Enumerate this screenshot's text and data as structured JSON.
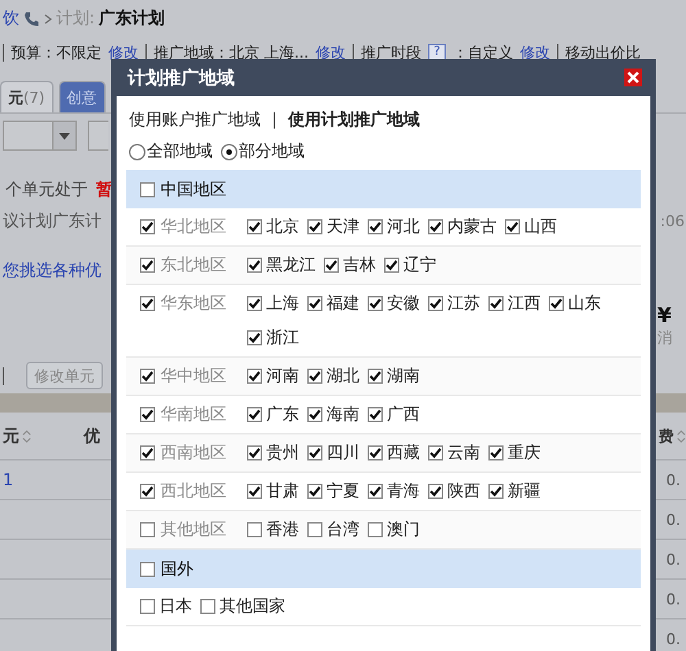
{
  "page": {
    "breadcrumb": {
      "parent": "饮",
      "section": "计划:",
      "current": "广东计划"
    },
    "info_bar": [
      {
        "label": "预算：不限定",
        "link": "修改"
      },
      {
        "label": "推广地域：北京 上海...",
        "link": "修改"
      },
      {
        "label": "推广时段",
        "help": "?",
        "suffix": "：自定义",
        "link": "修改"
      },
      {
        "label": "移动出价比"
      }
    ],
    "tabs": [
      {
        "label": "元",
        "count": "(7)",
        "selected": true
      },
      {
        "label": "创意",
        "selected": false
      }
    ],
    "notice": {
      "text": "个单元处于",
      "status": "暂"
    },
    "suggestion": "议计划广东计",
    "time": ":06",
    "promo_link": "您挑选各种优",
    "spend": {
      "amount": "¥",
      "label": "消"
    },
    "edit_button": "修改单元",
    "table": {
      "columns": [
        "元",
        "优",
        "费"
      ],
      "rows": [
        {
          "column_1": "1",
          "column_3": "0."
        },
        {
          "column_3": "0."
        },
        {
          "column_3": "0."
        },
        {
          "column_3": "0."
        },
        {
          "column_3": "0."
        }
      ]
    }
  },
  "dialog": {
    "title": "计划推广地域",
    "source_separator": "|",
    "source_tabs": [
      {
        "label": "使用账户推广地域",
        "selected": false
      },
      {
        "label": "使用计划推广地域",
        "selected": true
      }
    ],
    "scope": [
      {
        "label": "全部地域",
        "selected": false
      },
      {
        "label": "部分地域",
        "selected": true
      }
    ],
    "groups": [
      {
        "label": "中国地区",
        "checked": false,
        "regions": [
          {
            "label": "华北地区",
            "checked": true,
            "items": [
              {
                "label": "北京",
                "checked": true
              },
              {
                "label": "天津",
                "checked": true
              },
              {
                "label": "河北",
                "checked": true
              },
              {
                "label": "内蒙古",
                "checked": true
              },
              {
                "label": "山西",
                "checked": true
              }
            ]
          },
          {
            "label": "东北地区",
            "checked": true,
            "items": [
              {
                "label": "黑龙江",
                "checked": true
              },
              {
                "label": "吉林",
                "checked": true
              },
              {
                "label": "辽宁",
                "checked": true
              }
            ]
          },
          {
            "label": "华东地区",
            "checked": true,
            "items": [
              {
                "label": "上海",
                "checked": true
              },
              {
                "label": "福建",
                "checked": true
              },
              {
                "label": "安徽",
                "checked": true
              },
              {
                "label": "江苏",
                "checked": true
              },
              {
                "label": "江西",
                "checked": true
              },
              {
                "label": "山东",
                "checked": true
              },
              {
                "label": "浙江",
                "checked": true
              }
            ]
          },
          {
            "label": "华中地区",
            "checked": true,
            "items": [
              {
                "label": "河南",
                "checked": true
              },
              {
                "label": "湖北",
                "checked": true
              },
              {
                "label": "湖南",
                "checked": true
              }
            ]
          },
          {
            "label": "华南地区",
            "checked": true,
            "items": [
              {
                "label": "广东",
                "checked": true
              },
              {
                "label": "海南",
                "checked": true
              },
              {
                "label": "广西",
                "checked": true
              }
            ]
          },
          {
            "label": "西南地区",
            "checked": true,
            "items": [
              {
                "label": "贵州",
                "checked": true
              },
              {
                "label": "四川",
                "checked": true
              },
              {
                "label": "西藏",
                "checked": true
              },
              {
                "label": "云南",
                "checked": true
              },
              {
                "label": "重庆",
                "checked": true
              }
            ]
          },
          {
            "label": "西北地区",
            "checked": true,
            "items": [
              {
                "label": "甘肃",
                "checked": true
              },
              {
                "label": "宁夏",
                "checked": true
              },
              {
                "label": "青海",
                "checked": true
              },
              {
                "label": "陕西",
                "checked": true
              },
              {
                "label": "新疆",
                "checked": true
              }
            ]
          },
          {
            "label": "其他地区",
            "checked": false,
            "items": [
              {
                "label": "香港",
                "checked": false
              },
              {
                "label": "台湾",
                "checked": false
              },
              {
                "label": "澳门",
                "checked": false
              }
            ]
          }
        ]
      },
      {
        "label": "国外",
        "checked": false,
        "items": [
          {
            "label": "日本",
            "checked": false
          },
          {
            "label": "其他国家",
            "checked": false
          }
        ]
      }
    ]
  }
}
